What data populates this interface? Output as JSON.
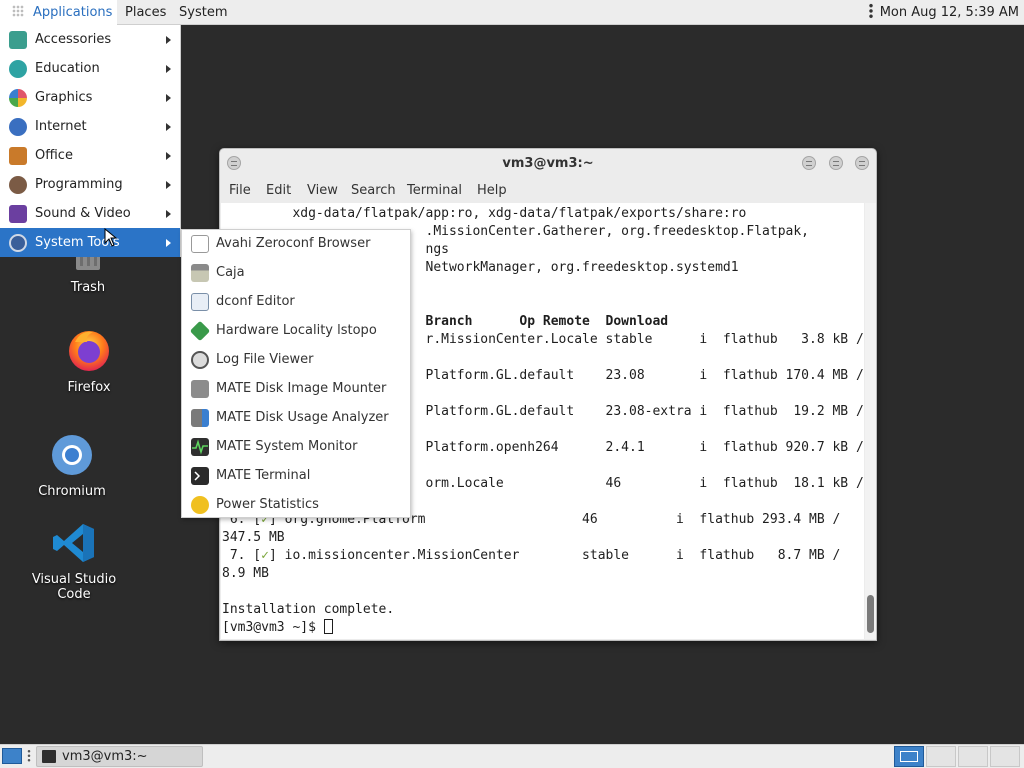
{
  "top_panel": {
    "applications_label": "Applications",
    "places_label": "Places",
    "system_label": "System",
    "clock": "Mon Aug 12,  5:39 AM"
  },
  "desktop": {
    "icons": [
      {
        "label": "Trash",
        "icon": "trash-icon"
      },
      {
        "label": "Firefox",
        "icon": "firefox-icon"
      },
      {
        "label": "Chromium",
        "icon": "chromium-icon"
      },
      {
        "label": "Visual Studio Code",
        "icon": "vscode-icon"
      }
    ]
  },
  "apps_menu": {
    "items": [
      {
        "label": "Accessories",
        "icon": "accessories-icon",
        "color": "#3b9e8e"
      },
      {
        "label": "Education",
        "icon": "education-icon",
        "color": "#2ea3a3"
      },
      {
        "label": "Graphics",
        "icon": "graphics-icon",
        "color": "#e0566a"
      },
      {
        "label": "Internet",
        "icon": "internet-icon",
        "color": "#3a6fc0"
      },
      {
        "label": "Office",
        "icon": "office-icon",
        "color": "#c97a2a"
      },
      {
        "label": "Programming",
        "icon": "programming-icon",
        "color": "#7b5b45"
      },
      {
        "label": "Sound & Video",
        "icon": "sound-video-icon",
        "color": "#6b3fa0"
      },
      {
        "label": "System Tools",
        "icon": "system-tools-icon",
        "color": "#3a5f9a"
      }
    ]
  },
  "system_tools_submenu": {
    "items": [
      {
        "label": "Avahi Zeroconf Browser",
        "icon": "avahi-icon"
      },
      {
        "label": "Caja",
        "icon": "caja-icon"
      },
      {
        "label": "dconf Editor",
        "icon": "dconf-editor-icon"
      },
      {
        "label": "Hardware Locality lstopo",
        "icon": "hwloc-icon"
      },
      {
        "label": "Log File Viewer",
        "icon": "log-viewer-icon"
      },
      {
        "label": "MATE Disk Image Mounter",
        "icon": "disk-mounter-icon"
      },
      {
        "label": "MATE Disk Usage Analyzer",
        "icon": "disk-usage-icon"
      },
      {
        "label": "MATE System Monitor",
        "icon": "system-monitor-icon"
      },
      {
        "label": "MATE Terminal",
        "icon": "terminal-icon"
      },
      {
        "label": "Power Statistics",
        "icon": "power-stats-icon"
      }
    ]
  },
  "terminal": {
    "title": "vm3@vm3:~",
    "menu": [
      "File",
      "Edit",
      "View",
      "Search",
      "Terminal",
      "Help"
    ],
    "lines": {
      "l1": "         xdg-data/flatpak/app:ro, xdg-data/flatpak/exports/share:ro",
      "l2": "                          .MissionCenter.Gatherer, org.freedesktop.Flatpak,",
      "l3": "                          ngs",
      "l4": "                          NetworkManager, org.freedesktop.systemd1",
      "header": "                          Branch      Op Remote  Download",
      "r1": "                          r.MissionCenter.Locale stable      i  flathub   3.8 kB /",
      "r2": "                          Platform.GL.default    23.08       i  flathub 170.4 MB /",
      "r3": "                          Platform.GL.default    23.08-extra i  flathub  19.2 MB /",
      "r4": "                          Platform.openh264      2.4.1       i  flathub 920.7 kB /",
      "r5": "                          orm.Locale             46          i  flathub  18.1 kB /",
      "r6_prefix": " 6. [",
      "r6_check": "✓",
      "r6_rest": "] org.gnome.Platform                    46          i  flathub 293.4 MB /",
      "r6b": "347.5 MB",
      "r7_prefix": " 7. [",
      "r7_check": "✓",
      "r7_rest": "] io.missioncenter.MissionCenter        stable      i  flathub   8.7 MB /",
      "r7b": "8.9 MB",
      "done": "Installation complete.",
      "prompt": "[vm3@vm3 ~]$ "
    }
  },
  "bottom_panel": {
    "task_label": "vm3@vm3:~",
    "workspaces": 4
  }
}
